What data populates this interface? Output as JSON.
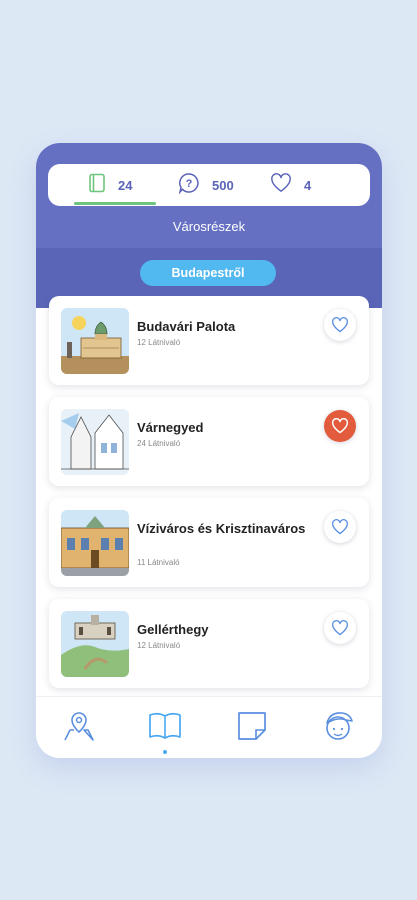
{
  "stats": {
    "read_count": "24",
    "quiz_count": "500",
    "favorites_count": "4",
    "active_color": "#6dc57d"
  },
  "section_title": "Városrészek",
  "filter_label": "Budapestről",
  "cards": [
    {
      "title": "Budavári Palota",
      "subtitle": "12 Látnivaló",
      "favorite": false
    },
    {
      "title": "Várnegyed",
      "subtitle": "24 Látnivaló",
      "favorite": true
    },
    {
      "title": "Víziváros és Krisztinaváros",
      "subtitle": "11 Látnivaló",
      "favorite": false
    },
    {
      "title": "Gellérthegy",
      "subtitle": "12 Látnivaló",
      "favorite": false
    }
  ],
  "nav": {
    "items": [
      "map-pin-icon",
      "book-icon",
      "sticky-note-icon",
      "profile-icon"
    ],
    "active": "book-icon"
  },
  "colors": {
    "header": "#6570c2",
    "accent": "#52b8f0",
    "favorite_active": "#e25b3c"
  }
}
